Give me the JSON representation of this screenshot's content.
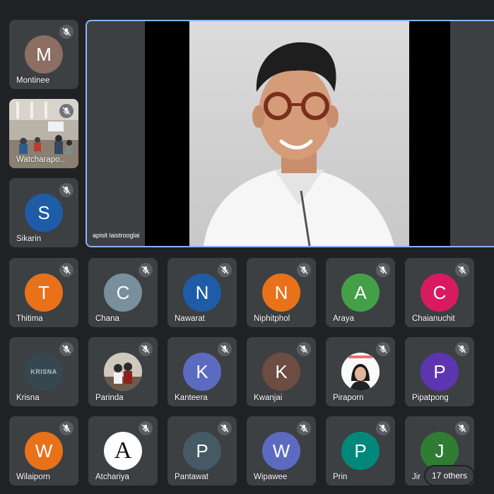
{
  "featured": {
    "name": "apisit laistrooglai"
  },
  "side": [
    {
      "name": "Montinee",
      "initial": "M",
      "color": "#8d6e63"
    },
    {
      "name": "Watcharapo...",
      "initial": "",
      "color": ""
    },
    {
      "name": "Sikarin",
      "initial": "S",
      "color": "#1e5ca8"
    }
  ],
  "rows": [
    [
      {
        "name": "Thitima",
        "initial": "T",
        "color": "#e8711a"
      },
      {
        "name": "Chana",
        "initial": "C",
        "color": "#78909c"
      },
      {
        "name": "Nawarat",
        "initial": "N",
        "color": "#1e5ca8"
      },
      {
        "name": "Niphitphol",
        "initial": "N",
        "color": "#e8711a"
      },
      {
        "name": "Araya",
        "initial": "A",
        "color": "#43a047"
      },
      {
        "name": "Chaianuchit",
        "initial": "C",
        "color": "#d81b60"
      }
    ],
    [
      {
        "name": "Krisna",
        "initial": "KRISNA",
        "color": "#37474f"
      },
      {
        "name": "Parinda",
        "initial": "",
        "color": ""
      },
      {
        "name": "Kanteera",
        "initial": "K",
        "color": "#5c6bc0"
      },
      {
        "name": "Kwanjai",
        "initial": "K",
        "color": "#6d4c41"
      },
      {
        "name": "Piraporn",
        "initial": "",
        "color": ""
      },
      {
        "name": "Pipatpong",
        "initial": "P",
        "color": "#5e35b1"
      }
    ],
    [
      {
        "name": "Wilaiporn",
        "initial": "W",
        "color": "#e8711a"
      },
      {
        "name": "Atchariya",
        "initial": "A",
        "color": "#ffffff"
      },
      {
        "name": "Pantawat",
        "initial": "P",
        "color": "#455a64"
      },
      {
        "name": "Wipawee",
        "initial": "W",
        "color": "#5c6bc0"
      },
      {
        "name": "Prin",
        "initial": "P",
        "color": "#00897b"
      },
      {
        "name": "Jir",
        "initial": "J",
        "color": "#2e7d32"
      }
    ]
  ],
  "others_label": "17 others"
}
